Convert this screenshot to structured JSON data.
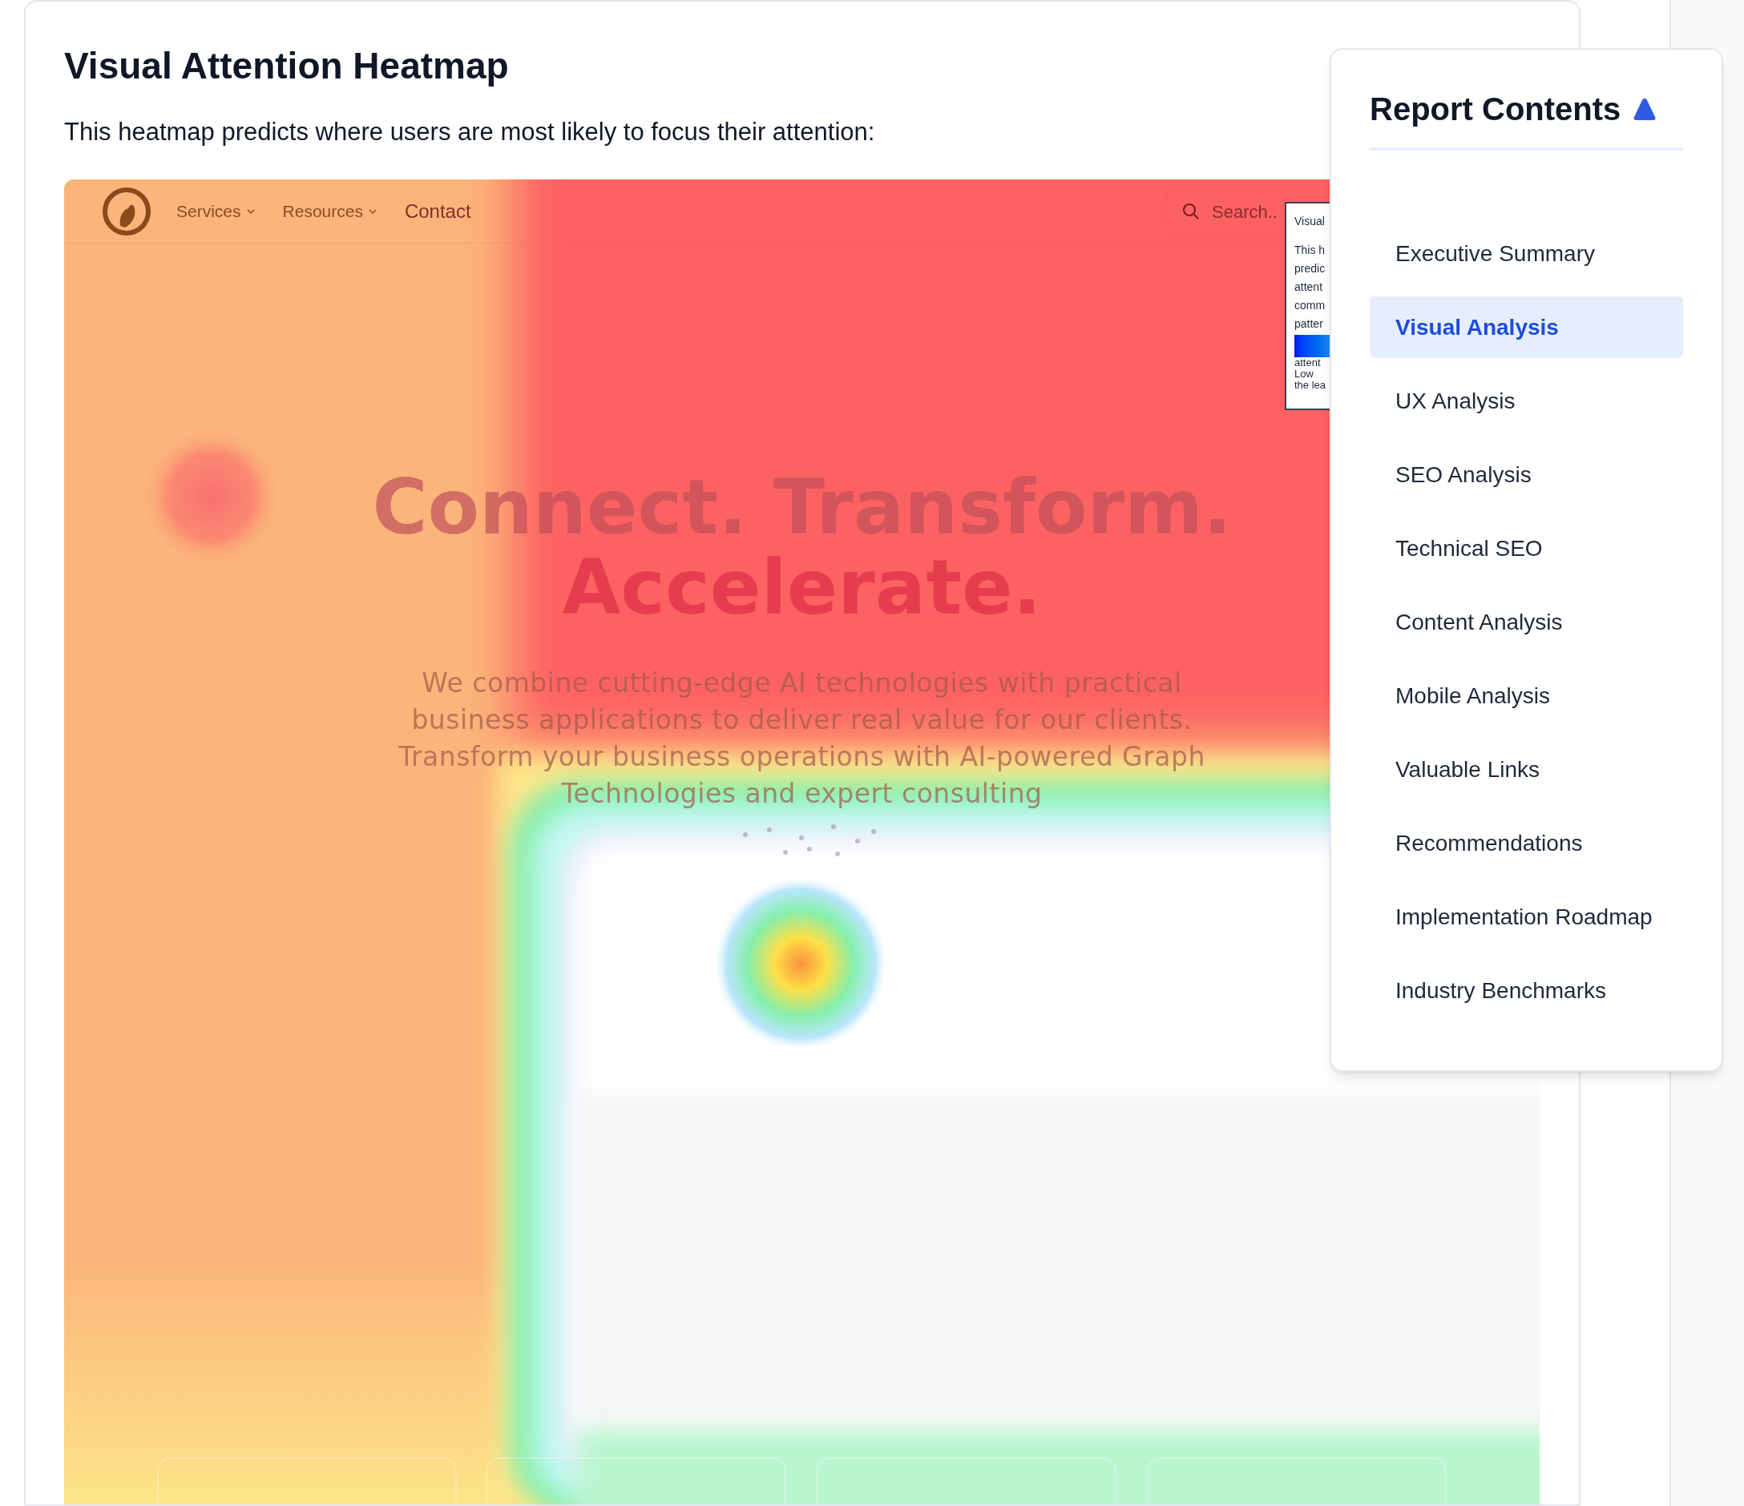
{
  "section": {
    "title": "Visual Attention Heatmap",
    "description": "This heatmap predicts where users are most likely to focus their attention:"
  },
  "heatmap": {
    "site_nav": [
      {
        "label": "Services",
        "dropdown": true
      },
      {
        "label": "Resources",
        "dropdown": true
      },
      {
        "label": "Contact",
        "dropdown": false
      }
    ],
    "search_placeholder": "Search..",
    "hero_lines": [
      "Connect. Transform.",
      "Accelerate."
    ],
    "hero_text": "We combine cutting-edge AI technologies with practical\nbusiness applications to deliver real value for our clients.\nTransform your business operations with AI-powered Graph\nTechnologies and expert consulting",
    "popup": {
      "title": "Visual",
      "lines": [
        "This h",
        "predic",
        "attent",
        "comm",
        "patter"
      ],
      "legend_lines": [
        "attent",
        "Low",
        "the lea"
      ]
    }
  },
  "toc": {
    "title": "Report Contents",
    "items": [
      {
        "label": "Executive Summary",
        "selected": false
      },
      {
        "label": "Visual Analysis",
        "selected": true
      },
      {
        "label": "UX Analysis",
        "selected": false
      },
      {
        "label": "SEO Analysis",
        "selected": false
      },
      {
        "label": "Technical SEO",
        "selected": false
      },
      {
        "label": "Content Analysis",
        "selected": false
      },
      {
        "label": "Mobile Analysis",
        "selected": false
      },
      {
        "label": "Valuable Links",
        "selected": false
      },
      {
        "label": "Recommendations",
        "selected": false
      },
      {
        "label": "Implementation Roadmap",
        "selected": false
      },
      {
        "label": "Industry Benchmarks",
        "selected": false
      }
    ]
  }
}
